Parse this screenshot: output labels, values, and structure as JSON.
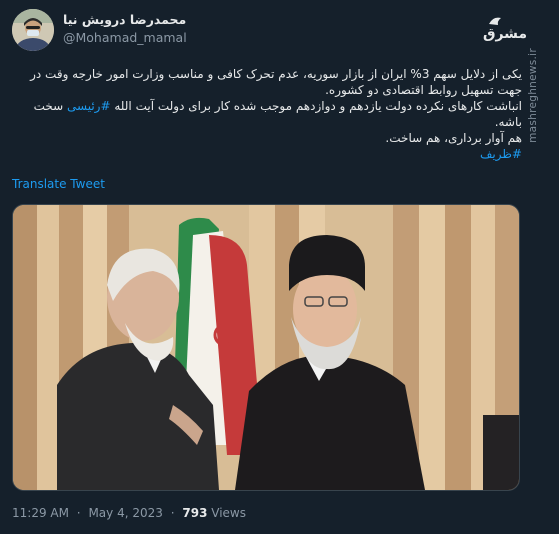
{
  "author": {
    "display_name": "محمدرضا درویش نیا",
    "handle": "@Mohamad_mamal"
  },
  "source_logo_text": "مشرق",
  "watermark": "mashreghnews.ir",
  "tweet": {
    "line1": "یکی از دلایل سهم 3% ایران از بازار سوریه، عدم تحرک کافی و مناسب وزارت امور خارجه وقت در",
    "line2": "جهت تسهیل روابط اقتصادی دو کشوره.",
    "line3_before": "انباشت کارهای نکرده دولت یازدهم و دوازدهم موجب شده کار برای دولت آیت الله ",
    "line3_hashtag": "#رئیسی",
    "line3_after": " سخت",
    "line4": "باشه.",
    "line5": "هم آوار برداری، هم ساخت.",
    "line6_hashtag": "#ظریف"
  },
  "translate_label": "Translate Tweet",
  "meta": {
    "time": "11:29 AM",
    "date": "May 4, 2023",
    "separator": "·",
    "views_count": "793",
    "views_label": "Views"
  },
  "colors": {
    "background": "#15202b",
    "text": "#e7e9ea",
    "secondary": "#8b98a5",
    "link": "#1d9bf0"
  }
}
